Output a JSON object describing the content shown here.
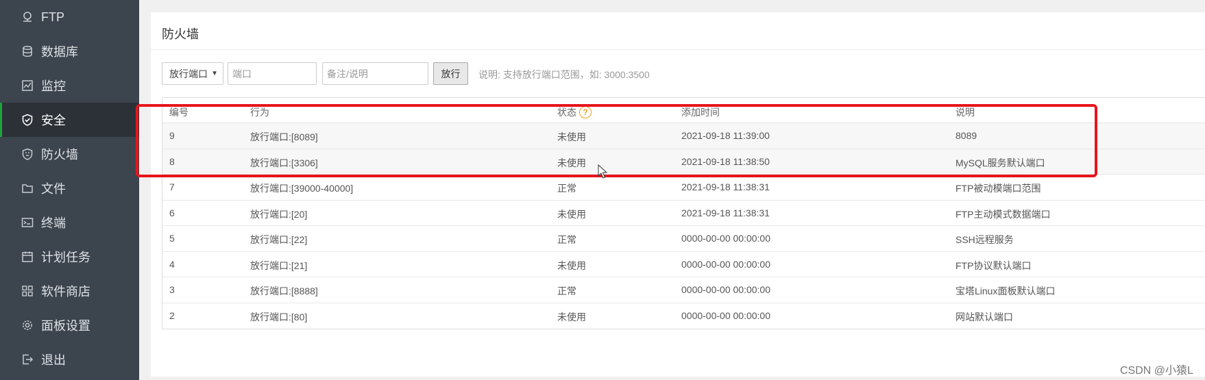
{
  "sidebar": {
    "items": [
      {
        "label": "FTP",
        "icon": "ftp-icon"
      },
      {
        "label": "数据库",
        "icon": "database-icon"
      },
      {
        "label": "监控",
        "icon": "monitor-icon"
      },
      {
        "label": "安全",
        "icon": "shield-icon",
        "active": true
      },
      {
        "label": "防火墙",
        "icon": "firewall-icon"
      },
      {
        "label": "文件",
        "icon": "folder-icon"
      },
      {
        "label": "终端",
        "icon": "terminal-icon"
      },
      {
        "label": "计划任务",
        "icon": "calendar-icon"
      },
      {
        "label": "软件商店",
        "icon": "grid-icon"
      },
      {
        "label": "面板设置",
        "icon": "gear-icon"
      },
      {
        "label": "退出",
        "icon": "logout-icon"
      }
    ]
  },
  "panel": {
    "title": "防火墙",
    "toolbar": {
      "select_value": "放行端口",
      "port_placeholder": "端口",
      "note_placeholder": "备注/说明",
      "submit_label": "放行",
      "hint": "说明: 支持放行端口范围，如: 3000:3500"
    },
    "table": {
      "headers": [
        "编号",
        "行为",
        "状态",
        "添加时间",
        "说明"
      ],
      "rows": [
        [
          "9",
          "放行端口:[8089]",
          "未使用",
          "2021-09-18 11:39:00",
          "8089"
        ],
        [
          "8",
          "放行端口:[3306]",
          "未使用",
          "2021-09-18 11:38:50",
          "MySQL服务默认端口"
        ],
        [
          "7",
          "放行端口:[39000-40000]",
          "正常",
          "2021-09-18 11:38:31",
          "FTP被动模端口范围"
        ],
        [
          "6",
          "放行端口:[20]",
          "未使用",
          "2021-09-18 11:38:31",
          "FTP主动模式数据端口"
        ],
        [
          "5",
          "放行端口:[22]",
          "正常",
          "0000-00-00 00:00:00",
          "SSH远程服务"
        ],
        [
          "4",
          "放行端口:[21]",
          "未使用",
          "0000-00-00 00:00:00",
          "FTP协议默认端口"
        ],
        [
          "3",
          "放行端口:[8888]",
          "正常",
          "0000-00-00 00:00:00",
          "宝塔Linux面板默认端口"
        ],
        [
          "2",
          "放行端口:[80]",
          "未使用",
          "0000-00-00 00:00:00",
          "网站默认端口"
        ]
      ]
    }
  },
  "watermark": "CSDN @小猿L",
  "colors": {
    "sidebar_bg": "#3c444d",
    "sidebar_active_bg": "#2c3138",
    "accent_green": "#20a53a",
    "highlight_red": "#e8141c",
    "help_orange": "#f0a020"
  }
}
